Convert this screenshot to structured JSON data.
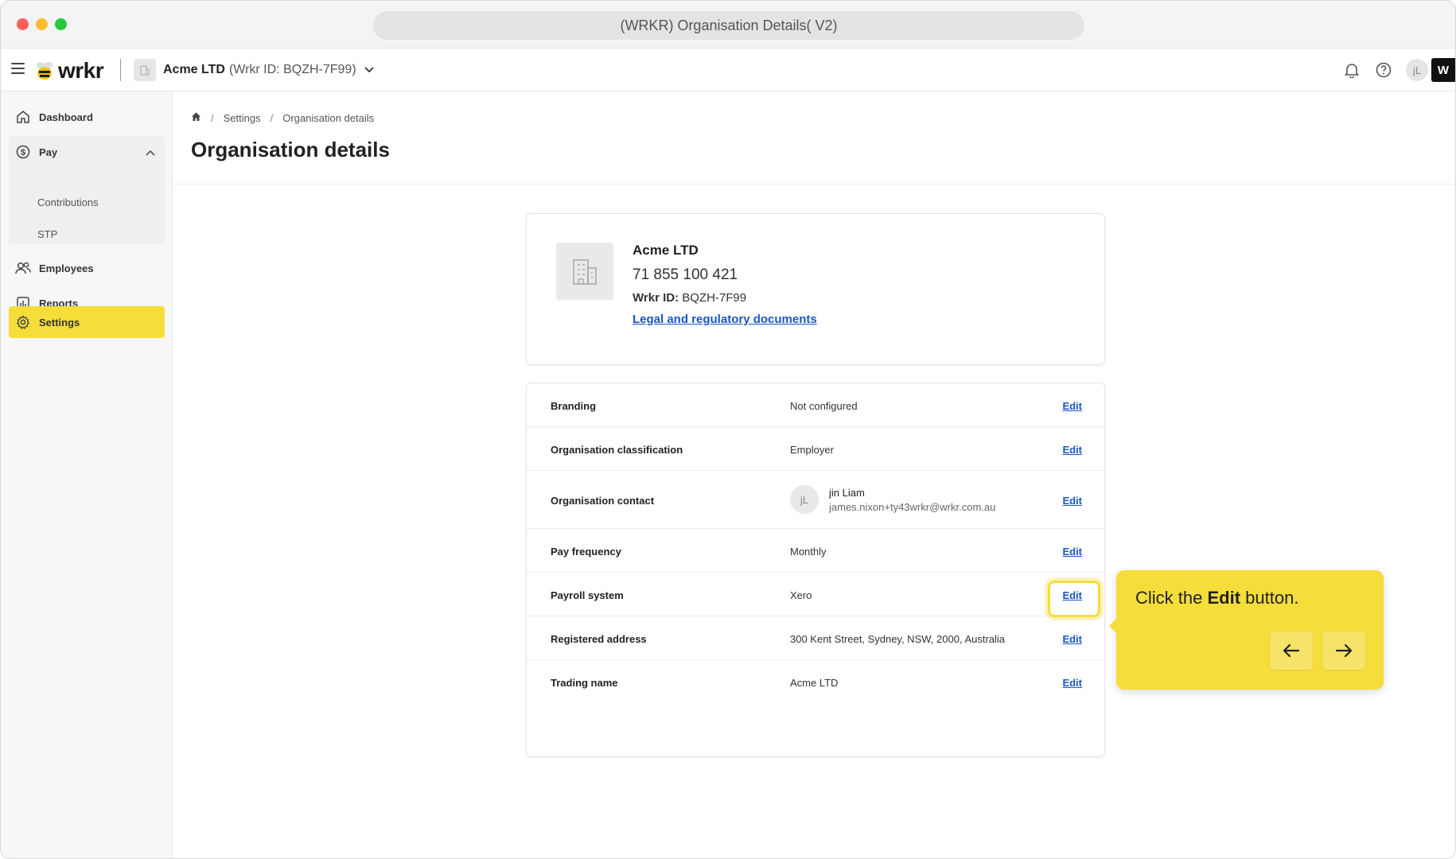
{
  "window": {
    "title": "(WRKR) Organisation Details( V2)"
  },
  "topnav": {
    "logo": "wrkr",
    "org_name": "Acme LTD",
    "org_id": "(Wrkr ID: BQZH-7F99)",
    "avatar_initials": "jL",
    "badge": "W",
    "icons": [
      "menu-icon",
      "bell-icon",
      "help-icon",
      "chevron-down-icon"
    ]
  },
  "sidebar": {
    "dashboard": "Dashboard",
    "pay": "Pay",
    "contributions": "Contributions",
    "stp": "STP",
    "employees": "Employees",
    "reports": "Reports",
    "settings": "Settings"
  },
  "breadcrumb": {
    "settings": "Settings",
    "current": "Organisation details",
    "sep1": "/",
    "sep2": "/"
  },
  "page_title": "Organisation details",
  "org_card": {
    "name": "Acme LTD",
    "abn": "71 855 100 421",
    "wrkr_id_label": "Wrkr ID:",
    "wrkr_id_value": "BQZH-7F99",
    "link": "Legal and regulatory documents"
  },
  "details": {
    "edit_label": "Edit",
    "branding": {
      "label": "Branding",
      "value": "Not configured"
    },
    "classification": {
      "label": "Organisation classification",
      "value": "Employer"
    },
    "contact": {
      "label": "Organisation contact",
      "initials": "jL",
      "name": "jin Liam",
      "email": "james.nixon+ty43wrkr@wrkr.com.au"
    },
    "pay_frequency": {
      "label": "Pay frequency",
      "value": "Monthly"
    },
    "payroll_system": {
      "label": "Payroll system",
      "value": "Xero"
    },
    "address": {
      "label": "Registered address",
      "value": "300 Kent Street, Sydney, NSW, 2000, Australia"
    },
    "trading_name": {
      "label": "Trading name",
      "value": "Acme LTD"
    }
  },
  "tooltip": {
    "pre": "Click the ",
    "bold": "Edit",
    "post": " button."
  },
  "colors": {
    "accent": "#f5dd3a",
    "link": "#1a56c4"
  }
}
